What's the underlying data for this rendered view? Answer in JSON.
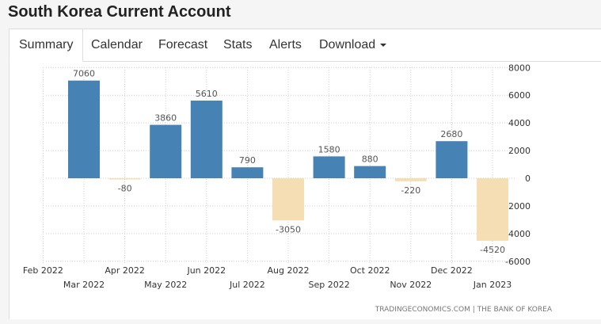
{
  "title": "South Korea Current Account",
  "tabs": [
    {
      "label": "Summary",
      "active": true
    },
    {
      "label": "Calendar"
    },
    {
      "label": "Forecast"
    },
    {
      "label": "Stats"
    },
    {
      "label": "Alerts"
    },
    {
      "label": "Download"
    }
  ],
  "chart_data": {
    "type": "bar",
    "x_ticks_upper": [
      "Feb 2022",
      "Apr 2022",
      "Jun 2022",
      "Aug 2022",
      "Oct 2022",
      "Dec 2022"
    ],
    "x_ticks_lower": [
      "Mar 2022",
      "May 2022",
      "Jul 2022",
      "Sep 2022",
      "Nov 2022",
      "Jan 2023"
    ],
    "categories": [
      "Mar 2022",
      "Apr 2022",
      "May 2022",
      "Jun 2022",
      "Jul 2022",
      "Aug 2022",
      "Sep 2022",
      "Oct 2022",
      "Nov 2022",
      "Dec 2022",
      "Jan 2023"
    ],
    "values": [
      7060,
      -80,
      3860,
      5610,
      790,
      -3050,
      1580,
      880,
      -220,
      2680,
      -4520
    ],
    "ylim": [
      -6000,
      8000
    ],
    "yticks": [
      8000,
      6000,
      4000,
      2000,
      0,
      -2000,
      -4000,
      -6000
    ],
    "grid": true,
    "colors": {
      "positive": "#4682b4",
      "negative": "#f5deb3"
    },
    "source": "TRADINGECONOMICS.COM  |  THE BANK OF KOREA"
  }
}
